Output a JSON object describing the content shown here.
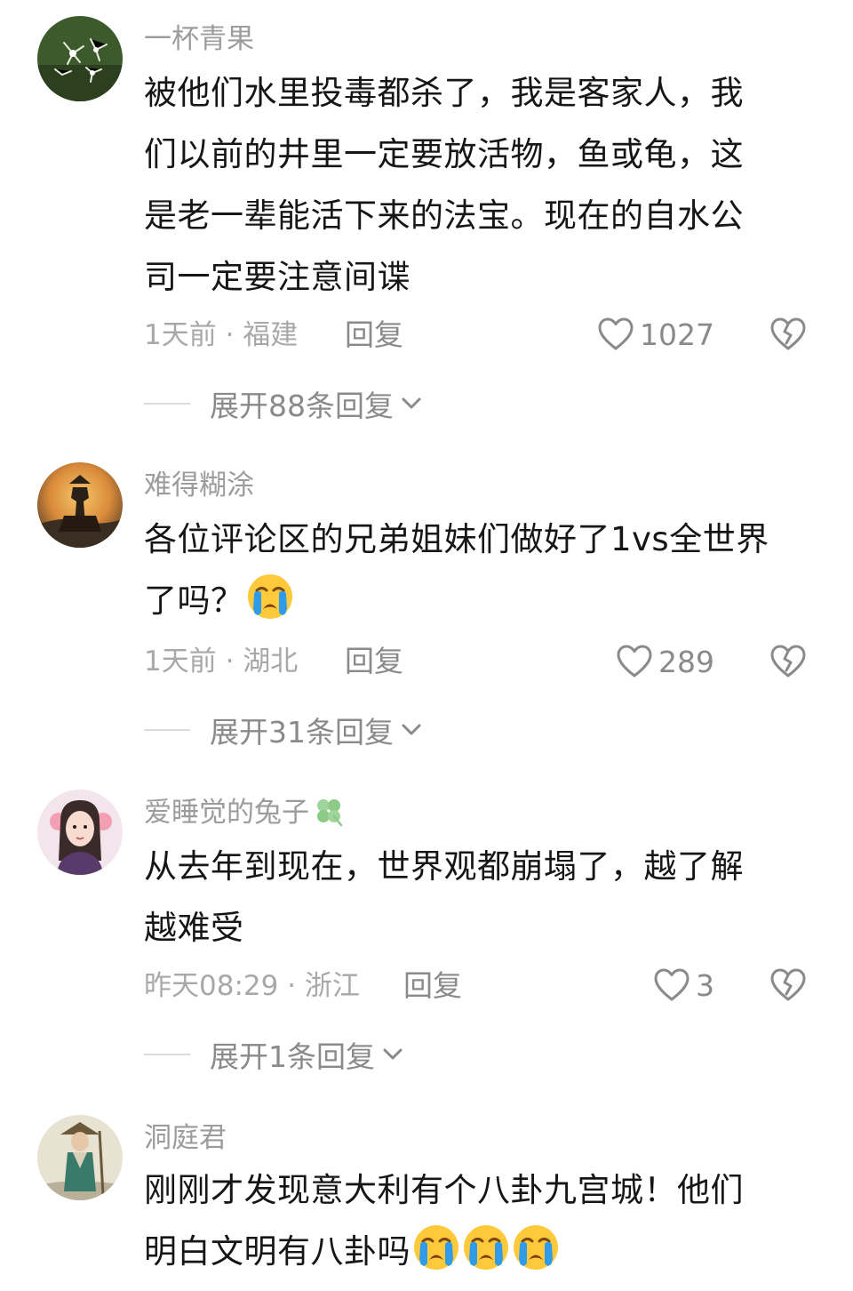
{
  "comments": [
    {
      "username": "一杯青果",
      "text_lines": [
        "被他们水里投毒都杀了，我是客家人，我",
        "们以前的井里一定要放活物，鱼或龟，这",
        "是老一辈能活下来的法宝。现在的自水公",
        "司一定要注意间谍"
      ],
      "meta": "1天前 · 福建",
      "reply_label": "回复",
      "likes": "1027",
      "expand_label": "展开88条回复",
      "avatar_icon": "flower-avatar"
    },
    {
      "username": "难得糊涂",
      "text_lines": [
        "各位评论区的兄弟姐妹们做好了1vs全世界",
        "了吗？"
      ],
      "trailing_emoji": "crying-emoji",
      "meta": "1天前 · 湖北",
      "reply_label": "回复",
      "likes": "289",
      "expand_label": "展开31条回复",
      "avatar_icon": "warrior-avatar"
    },
    {
      "username": "爱睡觉的兔子",
      "username_badge": "clover-icon",
      "text_lines": [
        "从去年到现在，世界观都崩塌了，越了解",
        "越难受"
      ],
      "meta": "昨天08:29 · 浙江",
      "reply_label": "回复",
      "likes": "3",
      "expand_label": "展开1条回复",
      "avatar_icon": "girl-avatar"
    },
    {
      "username": "洞庭君",
      "text_lines": [
        "刚刚才发现意大利有个八卦九宫城！他们",
        "明白文明有八卦吗"
      ],
      "trailing_emoji": "crying-emoji x3",
      "avatar_icon": "swordsman-avatar"
    }
  ],
  "colors": {
    "username": "#9c9c9c",
    "text": "#161616",
    "meta": "#a8a8a8",
    "action": "#8a8a8a",
    "emoji_face": "#FFC93C",
    "emoji_tear": "#2F9BEA"
  }
}
